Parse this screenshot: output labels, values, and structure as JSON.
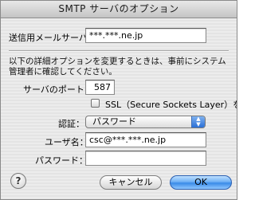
{
  "window": {
    "title": "SMTP サーバのオプション"
  },
  "outgoing_server": {
    "label": "送信用メールサーバ：",
    "value": "***.***.ne.jp"
  },
  "note": {
    "text": "以下の詳細オプションを変更するときは、事前にシステム管理者に確認してください。"
  },
  "port": {
    "label": "サーバのポート：",
    "value": "587"
  },
  "ssl": {
    "label": "SSL（Secure Sockets Layer）を使用",
    "checked": false
  },
  "auth": {
    "label": "認証：",
    "selected": "パスワード"
  },
  "username": {
    "label": "ユーザ名：",
    "value": "csc@***.***.ne.jp"
  },
  "password": {
    "label": "パスワード：",
    "value": ""
  },
  "buttons": {
    "help": "?",
    "cancel": "キャンセル",
    "ok": "OK"
  },
  "colors": {
    "default_button": "#3a8be8",
    "dialog_background": "#ececec"
  }
}
